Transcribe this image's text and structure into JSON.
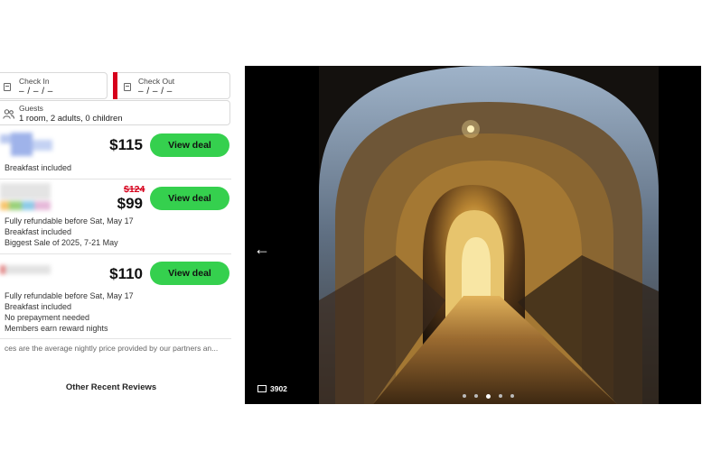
{
  "booking": {
    "check_in_label": "Check In",
    "check_in_value": "– / – / –",
    "check_out_label": "Check Out",
    "check_out_value": "– / – / –",
    "guests_label": "Guests",
    "guests_value": "1 room, 2 adults, 0 children"
  },
  "deals": [
    {
      "price": "$115",
      "old_price": "",
      "button": "View deal",
      "perks": [
        "Breakfast included"
      ]
    },
    {
      "price": "$99",
      "old_price": "$124",
      "button": "View deal",
      "perks": [
        "Fully refundable before Sat, May 17",
        "Breakfast included",
        "Biggest Sale of 2025, 7-21 May"
      ]
    },
    {
      "price": "$110",
      "old_price": "",
      "button": "View deal",
      "perks": [
        "Fully refundable before Sat, May 17",
        "Breakfast included",
        "No prepayment needed",
        "Members earn reward nights"
      ]
    }
  ],
  "disclaimer": "ces are the average nightly price provided by our partners an...",
  "other_reviews": "Other Recent Reviews",
  "gallery": {
    "photo_count": "3902",
    "dots_total": 5,
    "dots_active_index": 2
  },
  "colors": {
    "accent_green": "#35d04e",
    "sale_red": "#d6001c"
  },
  "icons": [
    "calendar-icon",
    "people-icon",
    "arrow-left-icon",
    "image-icon"
  ]
}
